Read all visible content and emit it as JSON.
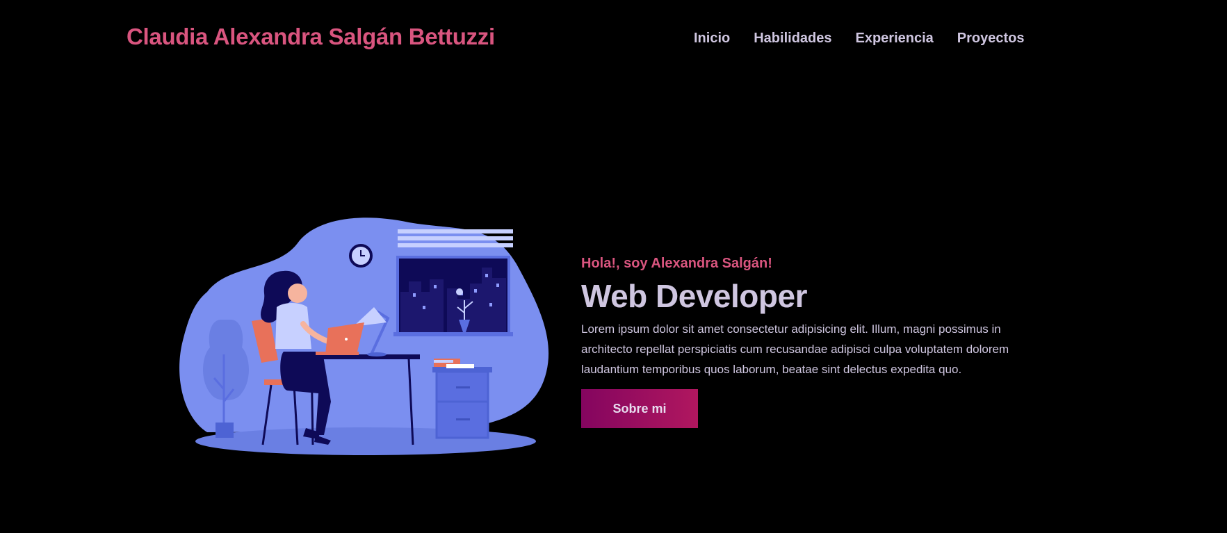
{
  "header": {
    "brand": "Claudia Alexandra Salgán Bettuzzi",
    "nav": [
      {
        "label": "Inicio"
      },
      {
        "label": "Habilidades"
      },
      {
        "label": "Experiencia"
      },
      {
        "label": "Proyectos"
      }
    ]
  },
  "hero": {
    "greeting": "Hola!, soy Alexandra Salgán!",
    "role": "Web Developer",
    "description": "Lorem ipsum dolor sit amet consectetur adipisicing elit. Illum, magni possimus in architecto repellat perspiciatis cum recusandae adipisci culpa voluptatem dolorem laudantium temporibus quos laborum, beatae sint delectus expedita quo.",
    "cta_label": "Sobre mi",
    "illustration_icon": "woman-working-on-laptop-illustration"
  },
  "colors": {
    "background": "#000000",
    "accent_pink": "#d9557f",
    "text": "#cfc6e0",
    "button_gradient_start": "#84055f",
    "button_gradient_end": "#b0175f",
    "illustration_blob": "#7b8ff0"
  }
}
